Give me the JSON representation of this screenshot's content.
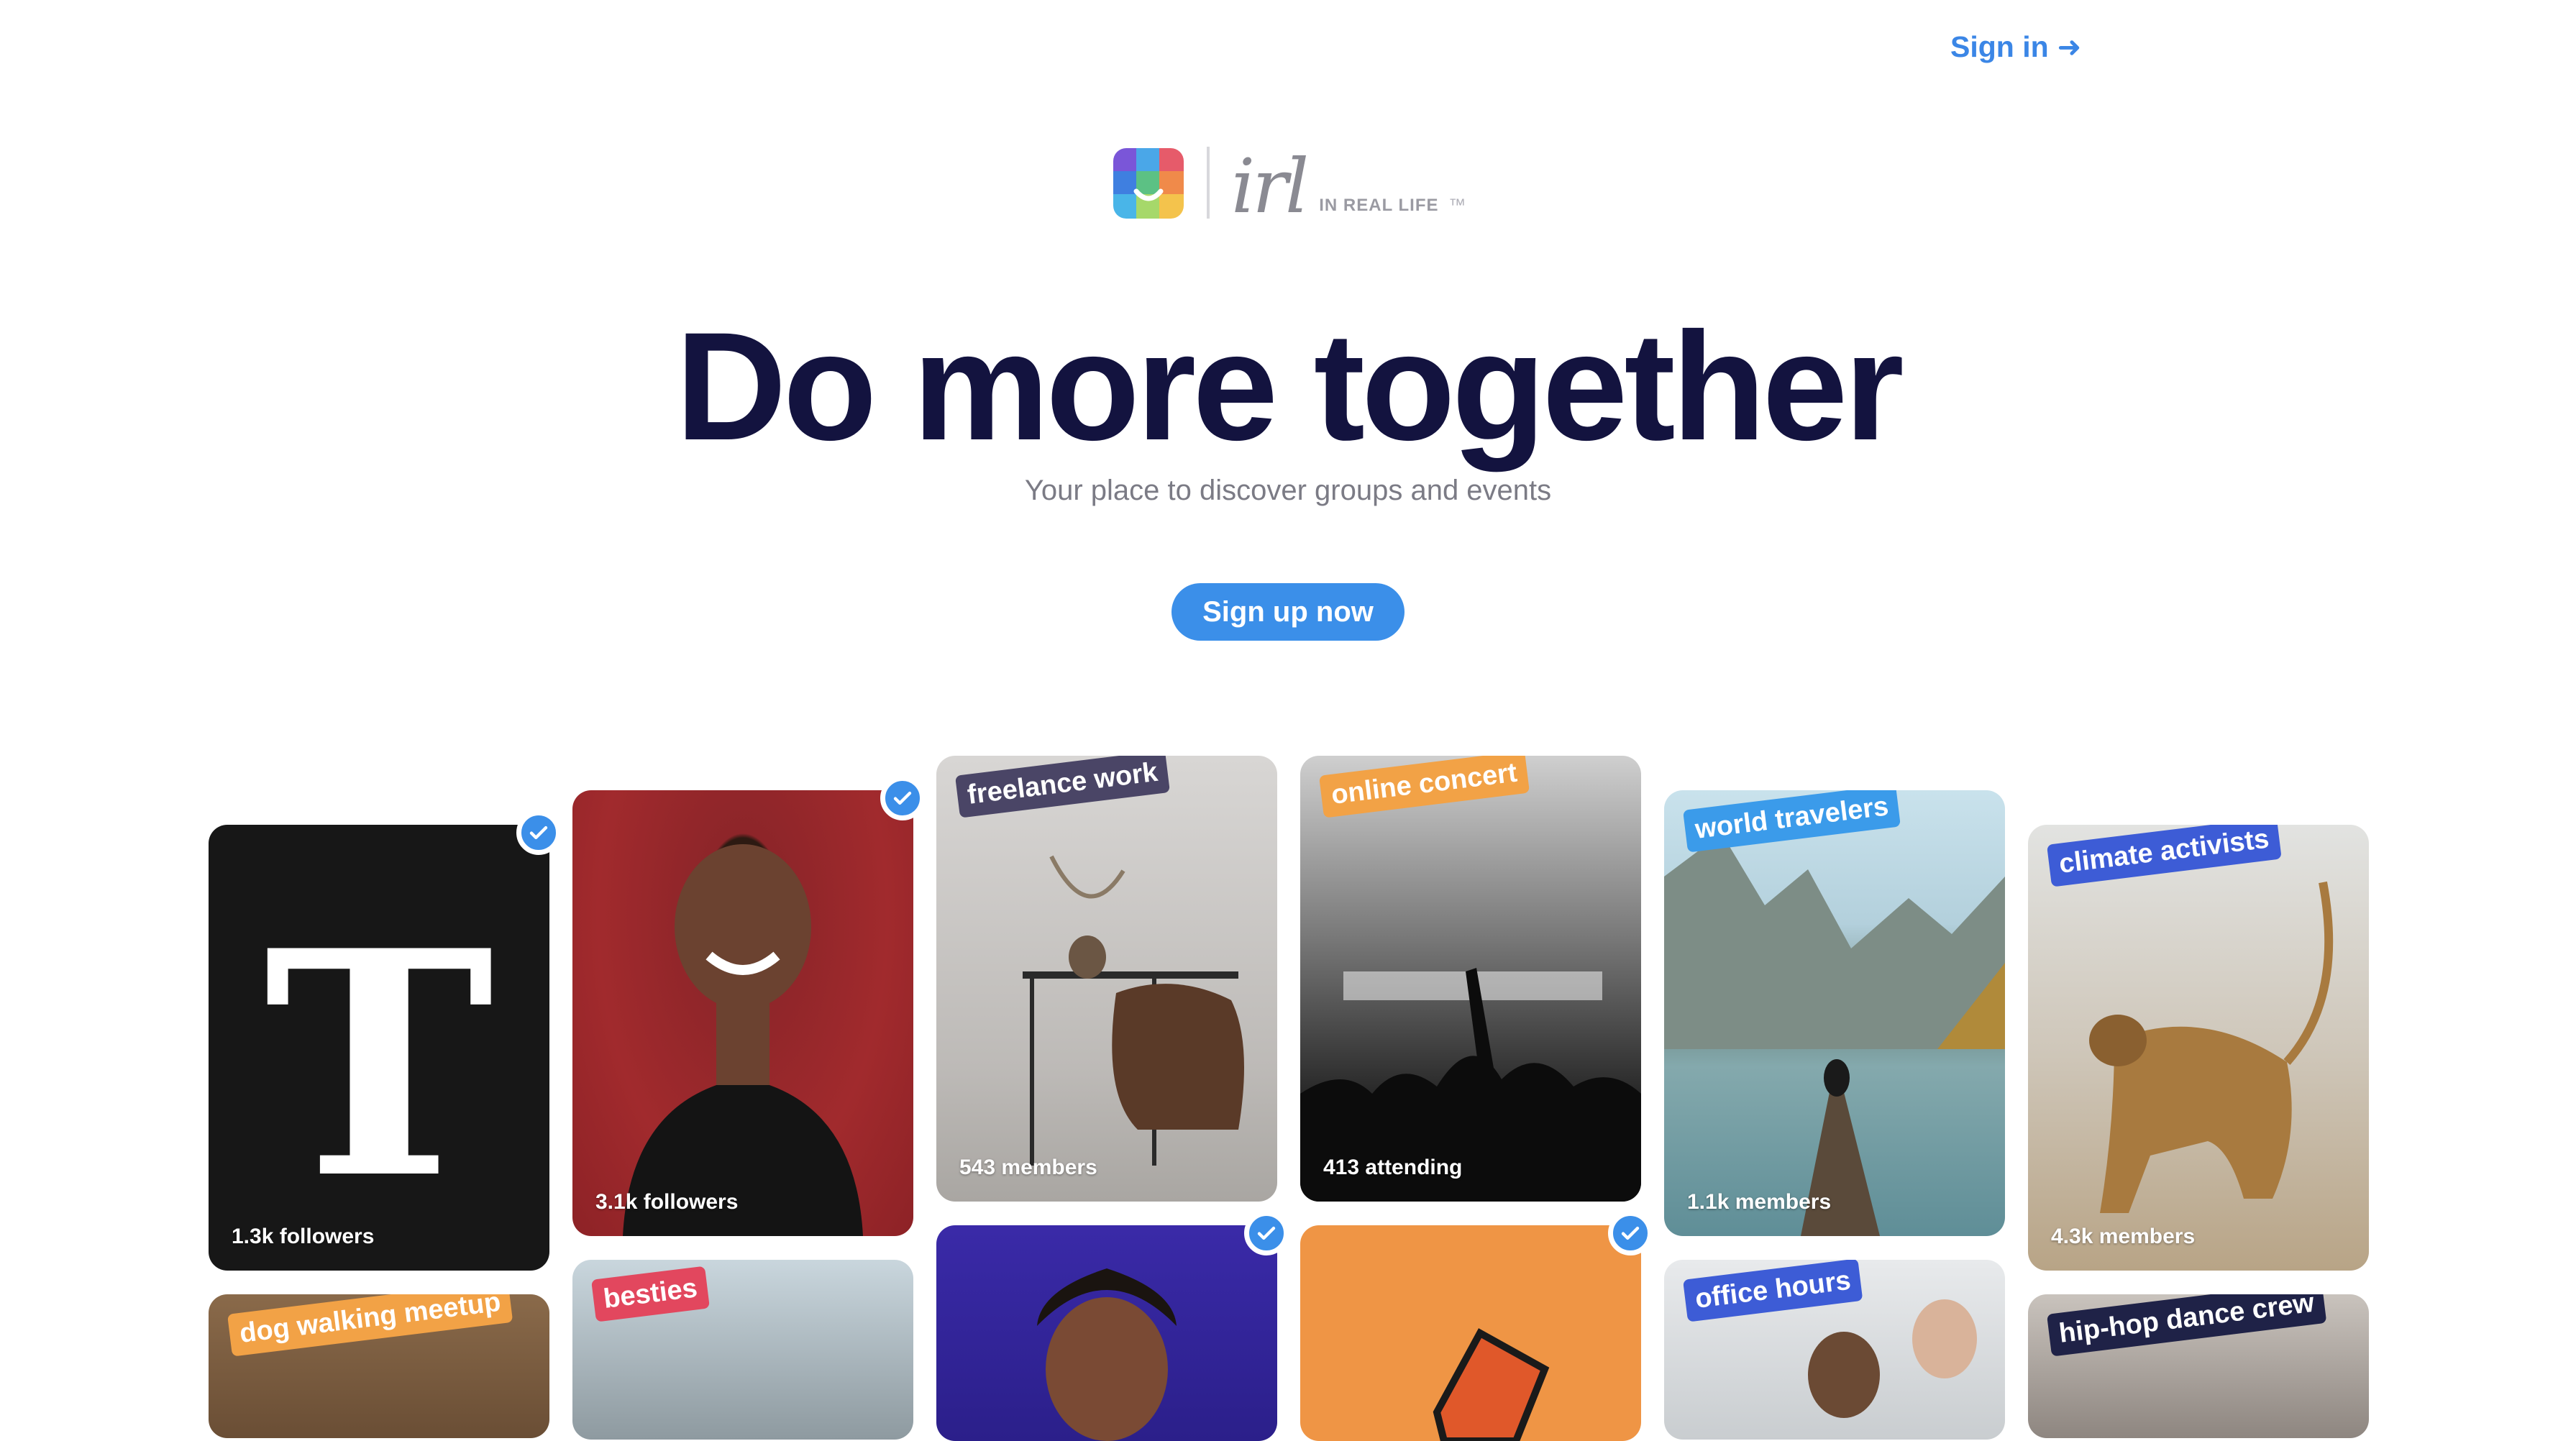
{
  "header": {
    "signin_label": "Sign in"
  },
  "logo": {
    "wordmark": "irl",
    "tagline": "IN REAL LIFE",
    "tm": "™"
  },
  "hero": {
    "title": "Do more together",
    "subtitle": "Your place to discover groups and events",
    "cta_label": "Sign up now"
  },
  "cards": {
    "nyt": {
      "stat": "1.3k followers",
      "verified": true,
      "logo_letter": "T"
    },
    "person": {
      "stat": "3.1k followers",
      "verified": true
    },
    "freelance": {
      "label": "freelance work",
      "stat": "543 members"
    },
    "concert": {
      "label": "online concert",
      "stat": "413 attending"
    },
    "travelers": {
      "label": "world travelers",
      "stat": "1.1k members"
    },
    "climate": {
      "label": "climate activists",
      "stat": "4.3k members"
    },
    "dog": {
      "label": "dog walking meetup"
    },
    "besties": {
      "label": "besties"
    },
    "singer": {
      "verified": true
    },
    "orange": {
      "verified": true
    },
    "office": {
      "label": "office hours"
    },
    "hiphop": {
      "label": "hip-hop dance crew"
    }
  },
  "colors": {
    "accent": "#3b8fe9",
    "hero_text": "#13133f",
    "label_freelance": "#4a4566",
    "label_concert": "#f2a246",
    "label_travelers": "#3b9bea",
    "label_climate": "#3d5cd6",
    "label_dog": "#f2a246",
    "label_besties": "#e2475e",
    "label_office": "#3d5cd6",
    "label_hiphop": "#1f2247"
  }
}
